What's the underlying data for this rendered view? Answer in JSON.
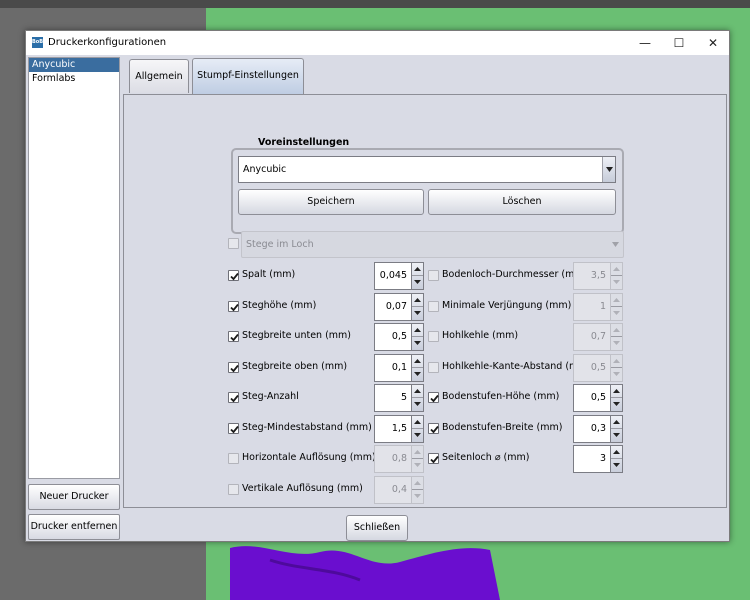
{
  "window": {
    "title": "Druckerkonfigurationen",
    "icon_text": "BoB"
  },
  "controls": {
    "minimize": "—",
    "maximize": "☐",
    "close": "✕"
  },
  "printers": [
    {
      "label": "Anycubic",
      "selected": true
    },
    {
      "label": "Formlabs",
      "selected": false
    }
  ],
  "sidebar_buttons": {
    "new": "Neuer Drucker",
    "remove": "Drucker entfernen"
  },
  "tabs": [
    {
      "label": "Allgemein",
      "active": false
    },
    {
      "label": "Stumpf-Einstellungen",
      "active": true
    }
  ],
  "presets": {
    "label": "Voreinstellungen",
    "selected": "Anycubic",
    "save": "Speichern",
    "delete": "Löschen"
  },
  "holes_combo": {
    "label": "Stege im Loch",
    "checked": false,
    "enabled": false
  },
  "left_settings": [
    {
      "label": "Spalt (mm)",
      "checked": true,
      "value": "0,045",
      "enabled": true
    },
    {
      "label": "Steghöhe (mm)",
      "checked": true,
      "value": "0,07",
      "enabled": true
    },
    {
      "label": "Stegbreite unten (mm)",
      "checked": true,
      "value": "0,5",
      "enabled": true
    },
    {
      "label": "Stegbreite oben (mm)",
      "checked": true,
      "value": "0,1",
      "enabled": true
    },
    {
      "label": "Steg-Anzahl",
      "checked": true,
      "value": "5",
      "enabled": true
    },
    {
      "label": "Steg-Mindestabstand (mm)",
      "checked": true,
      "value": "1,5",
      "enabled": true
    },
    {
      "label": "Horizontale Auflösung (mm)",
      "checked": false,
      "value": "0,8",
      "enabled": false
    },
    {
      "label": "Vertikale Auflösung (mm)",
      "checked": false,
      "value": "0,4",
      "enabled": false
    }
  ],
  "right_settings": [
    {
      "label": "Bodenloch-Durchmesser (mm)",
      "checked": false,
      "value": "3,5",
      "enabled": false
    },
    {
      "label": "Minimale Verjüngung (mm)",
      "checked": false,
      "value": "1",
      "enabled": false
    },
    {
      "label": "Hohlkehle (mm)",
      "checked": false,
      "value": "0,7",
      "enabled": false
    },
    {
      "label": "Hohlkehle-Kante-Abstand (mm)",
      "checked": false,
      "value": "0,5",
      "enabled": false
    },
    {
      "label": "Bodenstufen-Höhe (mm)",
      "checked": true,
      "value": "0,5",
      "enabled": true
    },
    {
      "label": "Bodenstufen-Breite (mm)",
      "checked": true,
      "value": "0,3",
      "enabled": true
    },
    {
      "label": "Seitenloch ⌀ (mm)",
      "checked": true,
      "value": "3",
      "enabled": true
    }
  ],
  "close_button": "Schließen",
  "colors": {
    "selection": "#3a6d9f",
    "panel": "#d9dbe5",
    "background_green": "#6abf73",
    "model_purple": "#6a0ecf"
  }
}
